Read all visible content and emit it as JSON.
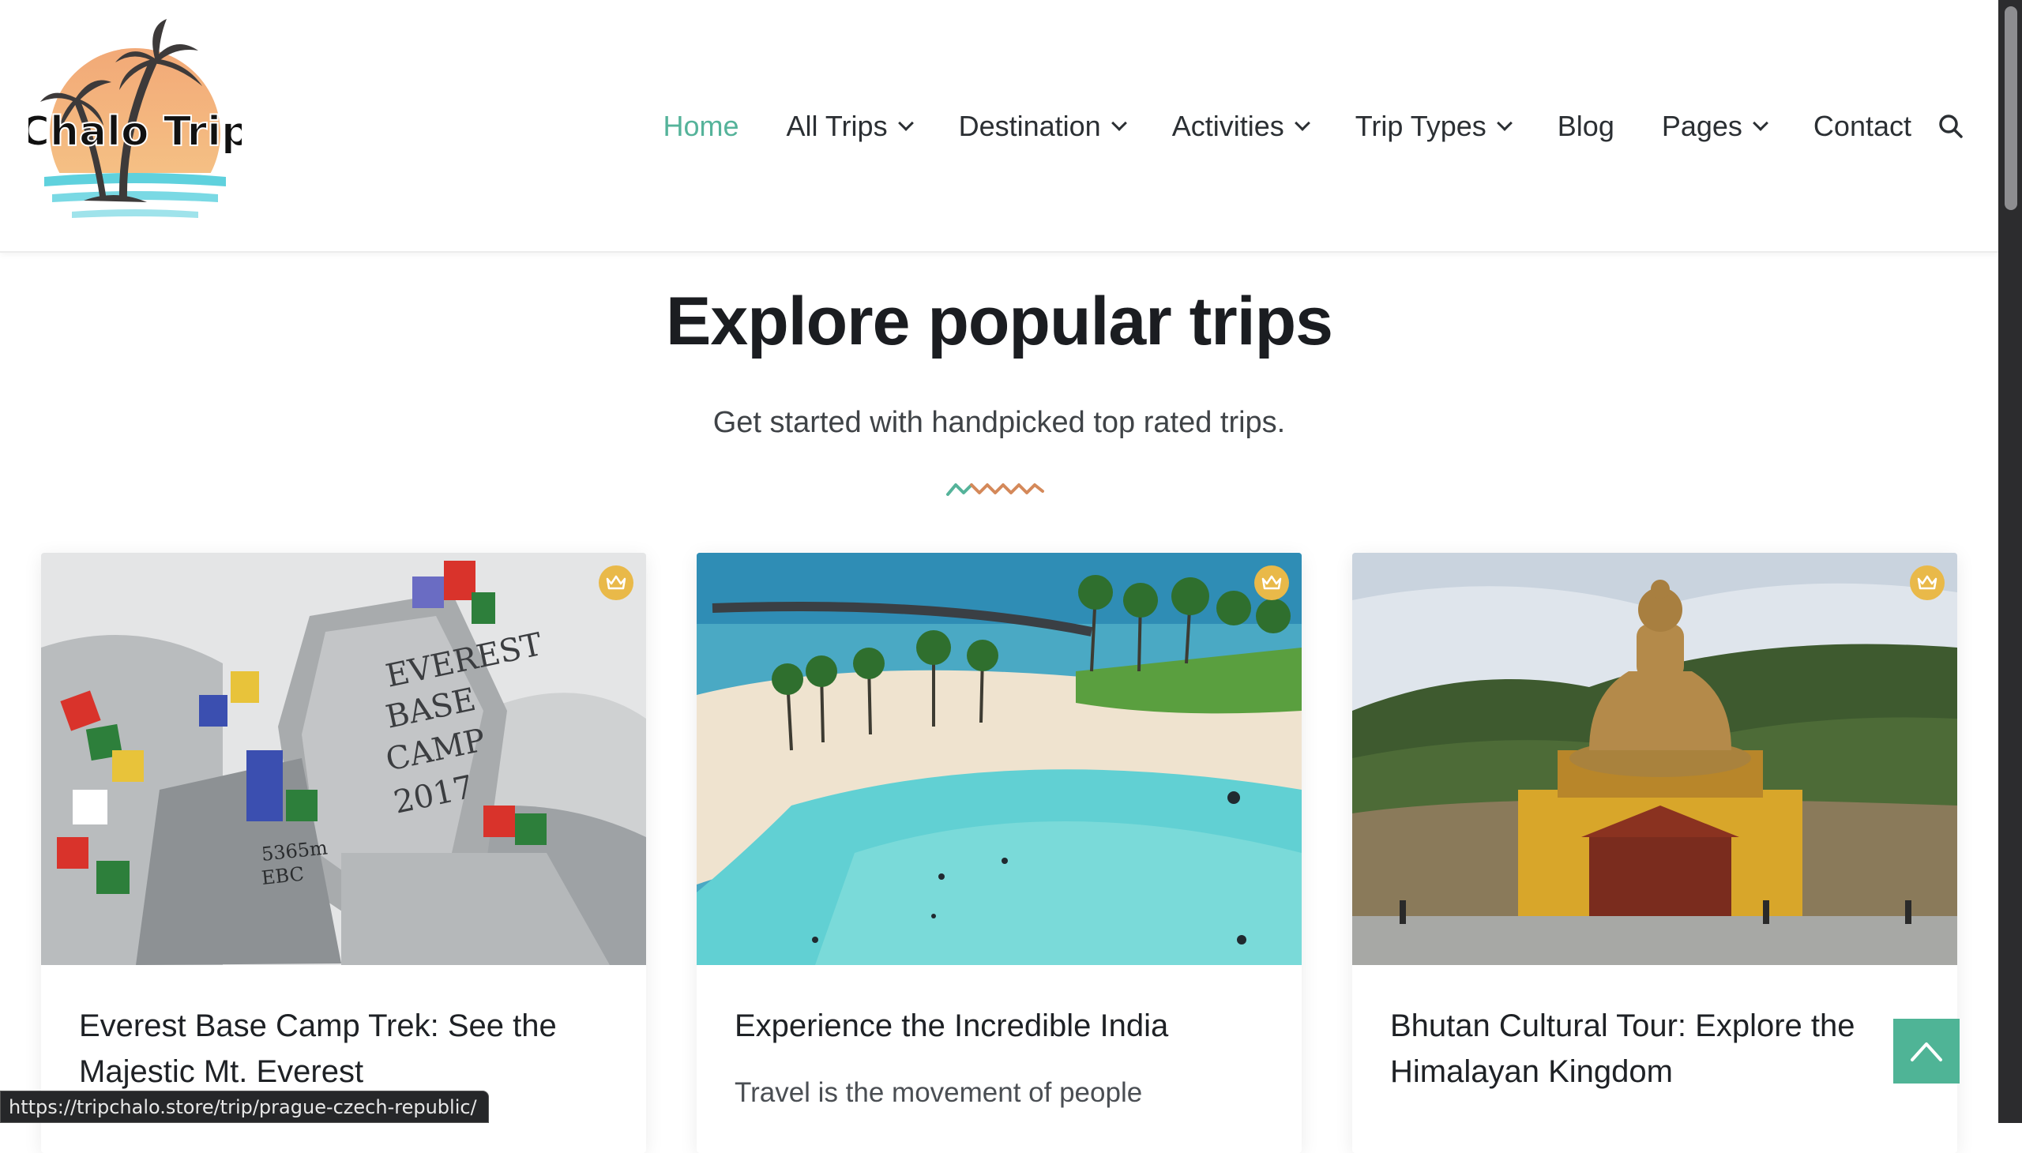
{
  "header": {
    "logo_text": "Chalo Trip",
    "nav": [
      {
        "label": "Home",
        "active": true,
        "dropdown": false
      },
      {
        "label": "All Trips",
        "dropdown": true
      },
      {
        "label": "Destination",
        "dropdown": true
      },
      {
        "label": "Activities",
        "dropdown": true
      },
      {
        "label": "Trip Types",
        "dropdown": true
      },
      {
        "label": "Blog",
        "dropdown": false
      },
      {
        "label": "Pages",
        "dropdown": true
      },
      {
        "label": "Contact",
        "dropdown": false
      }
    ],
    "search_icon": "search-icon"
  },
  "section": {
    "title": "Explore popular trips",
    "subtitle": "Get started with handpicked top rated trips."
  },
  "cards": [
    {
      "title": "Everest Base Camp Trek: See the Majestic Mt. Everest",
      "description": "",
      "badge_icon": "crown-icon"
    },
    {
      "title": "Experience the Incredible India",
      "description": "Travel is the movement of people",
      "badge_icon": "crown-icon"
    },
    {
      "title": "Bhutan Cultural Tour: Explore the Himalayan Kingdom",
      "description": "",
      "badge_icon": "crown-icon"
    }
  ],
  "status_url": "https://tripchalo.store/trip/prague-czech-republic/",
  "colors": {
    "accent": "#55b39a",
    "badge": "#e9b949",
    "back_to_top": "#4fb496"
  }
}
